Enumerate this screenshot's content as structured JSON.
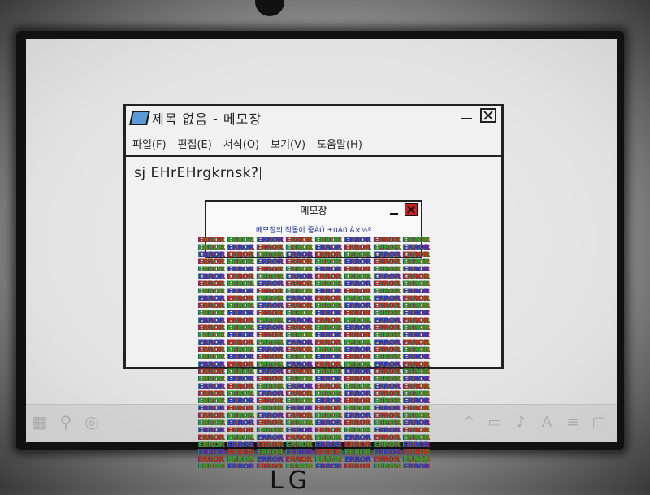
{
  "brand": {
    "logo_text": "LG"
  },
  "notepad": {
    "title": "제목 없음 - 메모장",
    "menu": [
      "파일(F)",
      "편집(E)",
      "서식(O)",
      "보기(V)",
      "도움말(H)"
    ],
    "content_text": "sj EHrEHrgkrnsk?"
  },
  "dialog": {
    "title": "메모장",
    "message": "메모장의 작동이 중ÀÚ ±úÀü Â×½º"
  },
  "error_grid": {
    "word": "ERROR",
    "rows": 32,
    "cols": 8,
    "colors": [
      "#d11a1a",
      "#1db01d",
      "#1e3ad6"
    ]
  },
  "taskbar": {
    "left_icons": [
      "grid-icon",
      "search-icon",
      "toggle-icon"
    ],
    "right_icons": [
      "chevron-up-icon",
      "chat-icon",
      "speaker-icon",
      "ime-icon",
      "clock-icon",
      "notification-icon"
    ]
  },
  "colors": {
    "dialog_close": "#cc2222",
    "dialog_message": "#1a2fa0",
    "notepad_icon": "#5b9ad6"
  }
}
